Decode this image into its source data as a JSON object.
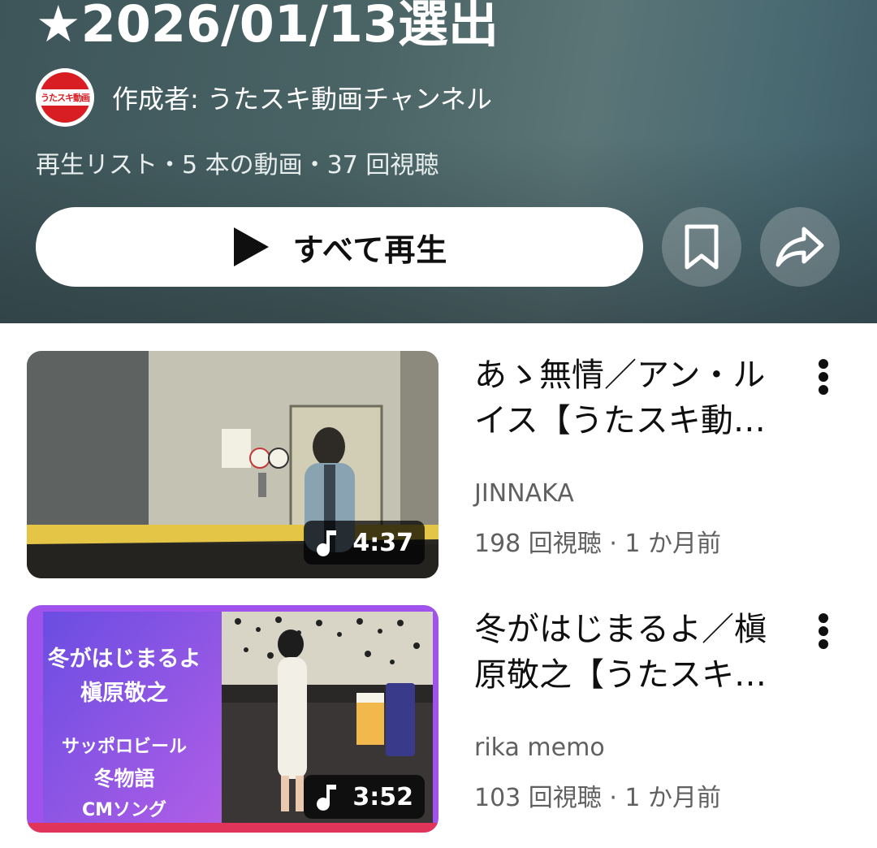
{
  "playlist": {
    "title": "★2026/01/13選出",
    "owner_prefix": "作成者:",
    "owner_name": "うたスキ動画チャンネル",
    "avatar_text": "うたスキ動画",
    "meta": "再生リスト・5 本の動画・37 回視聴",
    "play_all_label": "すべて再生",
    "save_icon": "bookmark-icon",
    "share_icon": "share-icon"
  },
  "videos": [
    {
      "title": "あゝ無情／アン・ルイス【うたスキ動画】",
      "channel": "JINNAKA",
      "views": "198 回視聴 · 1 か月前",
      "duration": "4:37",
      "thumb_colors": {
        "wall": "#b9b7a9",
        "floor": "#e3c84a",
        "door": "#cfcab4"
      }
    },
    {
      "title": "冬がはじまるよ／槇原敬之【うたスキ動画】",
      "channel": "rika memo",
      "views": "103 回視聴 · 1 か月前",
      "duration": "3:52",
      "thumb_text_line1": "冬がはじまるよ",
      "thumb_text_line2": "槇原敬之",
      "thumb_text_line3": "サッポロビール",
      "thumb_text_line4": "冬物語",
      "thumb_text_line5": "CMソング",
      "thumb_colors": {
        "panel": "#7d4fe0",
        "border": "#a25bf0",
        "bottom": "#e0345a"
      }
    }
  ],
  "colors": {
    "header_bg": "#4a6466",
    "avatar_red": "#d81e22",
    "text_secondary": "#606060"
  }
}
